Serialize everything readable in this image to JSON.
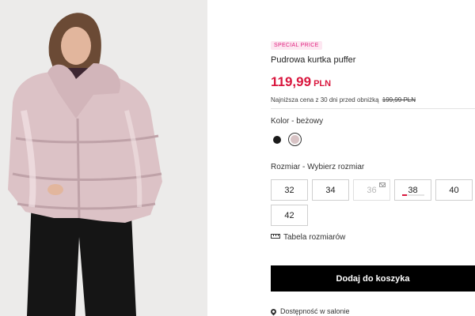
{
  "product": {
    "badge": "SPECIAL PRICE",
    "title": "Pudrowa kurtka puffer",
    "price": {
      "amount": "119,99",
      "currency": "PLN",
      "color": "#d9173e"
    },
    "lowest_price": {
      "text": "Najniższa cena z 30 dni przed obniżką",
      "old_price": "199,99 PLN"
    },
    "image": {
      "alt": "Pudrowa kurtka puffer"
    }
  },
  "color": {
    "label": "Kolor - beżowy",
    "swatches": [
      {
        "name": "czarny",
        "hex": "#1a1a1a",
        "selected": false
      },
      {
        "name": "beżowy",
        "hex": "#d8c3c5",
        "selected": true
      }
    ]
  },
  "size": {
    "label": "Rozmiar - Wybierz rozmiar",
    "options": [
      {
        "label": "32",
        "available": true
      },
      {
        "label": "34",
        "available": true
      },
      {
        "label": "36",
        "available": false,
        "notify_icon": "mail-icon"
      },
      {
        "label": "38",
        "available": true,
        "low_stock_level": 0.2
      },
      {
        "label": "40",
        "available": true
      },
      {
        "label": "42",
        "available": true
      }
    ],
    "chart_link": "Tabela rozmiarów"
  },
  "cart": {
    "add_label": "Dodaj do koszyka"
  },
  "store": {
    "availability_label": "Dostępność w salonie"
  },
  "colors": {
    "accent": "#d9173e",
    "badge": "#e0217f",
    "button": "#000000"
  }
}
